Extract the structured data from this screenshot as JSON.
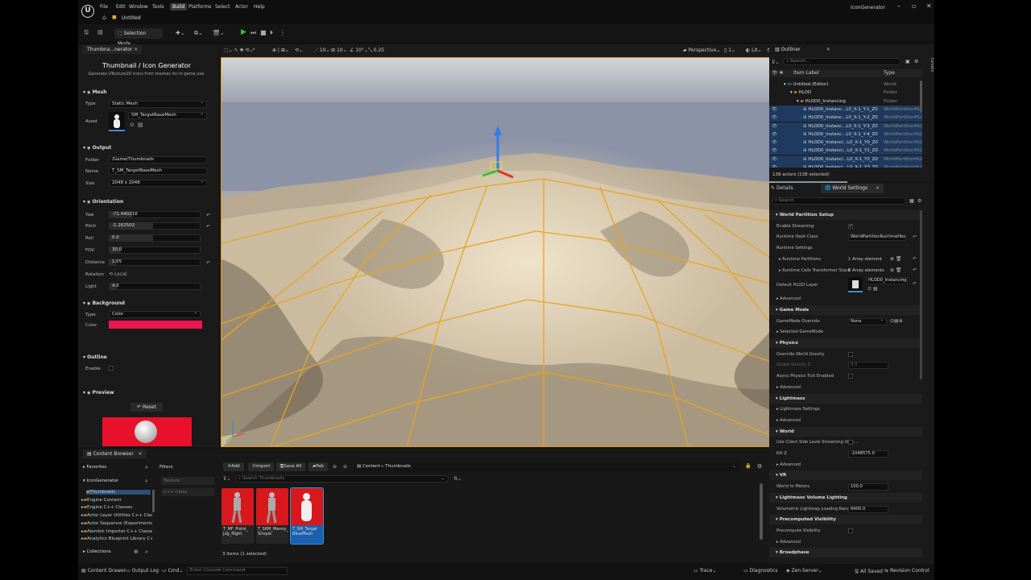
{
  "window": {
    "title": "IconGenerator",
    "tab": "Untitled"
  },
  "menu": [
    "File",
    "Edit",
    "Window",
    "Tools",
    "Build",
    "Platforms",
    "Select",
    "Actor",
    "Help"
  ],
  "toolbar": {
    "mode": "Selection Mode"
  },
  "left_panel": {
    "tab": "Thumbna...nerator",
    "title": "Thumbnail / Icon Generator",
    "subtitle": "Generate UTexture2D icons from meshes for in-game use.",
    "mesh": {
      "section": "Mesh",
      "type_label": "Type",
      "type_value": "Static Mesh",
      "asset_label": "Asset",
      "asset_value": "SM_TargetBaseMesh"
    },
    "output": {
      "section": "Output",
      "folder_label": "Folder",
      "folder_value": "/Game/Thumbnails",
      "name_label": "Name",
      "name_value": "T_SM_TargetBaseMesh",
      "size_label": "Size",
      "size_value": "2048 x 2048"
    },
    "orientation": {
      "section": "Orientation",
      "yaw_label": "Yaw",
      "yaw": "-71.440216",
      "pitch_label": "Pitch",
      "pitch": "-1.262502",
      "roll_label": "Roll",
      "roll": "0.0",
      "fov_label": "FOV",
      "fov": "30.0",
      "distance_label": "Distance",
      "distance": "1.05",
      "rotation_label": "Rotation",
      "rotation_value": "Local",
      "light_label": "Light",
      "light": "4.0"
    },
    "background": {
      "section": "Background",
      "type_label": "Type",
      "type_value": "Color",
      "color_label": "Color",
      "color_hex": "#ee1650"
    },
    "outline": {
      "section": "Outline",
      "enable_label": "Enable"
    },
    "preview": {
      "section": "Preview",
      "reset_label": "Reset"
    }
  },
  "viewport": {
    "view": "Perspective",
    "lit": "Lit",
    "grid_snap": "10",
    "rot_snap": "10°",
    "scale_snap": "0.25",
    "speed": "1"
  },
  "outliner": {
    "tab": "Outliner",
    "search_placeholder": "Search...",
    "col_label": "Item Label",
    "col_type": "Type",
    "rows": [
      {
        "label": "Untitled (Editor)",
        "type": "World",
        "indent": 0,
        "sel": false
      },
      {
        "label": "HLOD",
        "type": "Folder",
        "indent": 1,
        "sel": false
      },
      {
        "label": "HLOD0_Instancing",
        "type": "Folder",
        "indent": 2,
        "sel": false
      },
      {
        "label": "HLOD0_Instanc...L0_X-1_Y-1_Z0",
        "type": "WorldPartitionHLOD",
        "indent": 3,
        "sel": true
      },
      {
        "label": "HLOD0_Instanc...L0_X-1_Y-2_Z0",
        "type": "WorldPartitionHLOD",
        "indent": 3,
        "sel": true
      },
      {
        "label": "HLOD0_Instanc...L0_X-1_Y-3_Z0",
        "type": "WorldPartitionHLOD",
        "indent": 3,
        "sel": true
      },
      {
        "label": "HLOD0_Instanc...L0_X-1_Y-4_Z0",
        "type": "WorldPartitionHLOD",
        "indent": 3,
        "sel": true
      },
      {
        "label": "HLOD0_Instanci...L0_X-1_Y0_Z0",
        "type": "WorldPartitionHLOD",
        "indent": 3,
        "sel": true
      },
      {
        "label": "HLOD0_Instanci...L0_X-1_Y1_Z0",
        "type": "WorldPartitionHLOD",
        "indent": 3,
        "sel": true
      },
      {
        "label": "HLOD0_Instanci...L0_X-1_Y2_Z0",
        "type": "WorldPartitionHLOD",
        "indent": 3,
        "sel": true
      },
      {
        "label": "HLOD0_Instanci...L0_X-1_Y3_Z0",
        "type": "WorldPartitionHLOD",
        "indent": 3,
        "sel": true
      }
    ],
    "count": "138 actors (138 selected)"
  },
  "details": {
    "tab_details": "Details",
    "tab_world": "World Settings",
    "search_placeholder": "Search",
    "items": [
      {
        "kind": "sec",
        "text": "World Partition Setup"
      },
      {
        "kind": "check",
        "text": "Enable Streaming",
        "checked": true
      },
      {
        "kind": "drop",
        "text": "Runtime Hash Class",
        "value": "WorldPartitionRuntimeHashSet"
      },
      {
        "kind": "sub",
        "text": "Runtime Settings"
      },
      {
        "kind": "arr",
        "text": "Runtime Partitions",
        "value": "1 Array element"
      },
      {
        "kind": "arr",
        "text": "Runtime Cells Transformer Stack",
        "value": "0 Array elements"
      },
      {
        "kind": "hlod",
        "text": "Default HLOD Layer",
        "value": "HLOD0_Instancing"
      },
      {
        "kind": "adv",
        "text": "Advanced"
      },
      {
        "kind": "sec",
        "text": "Game Mode"
      },
      {
        "kind": "drop",
        "text": "GameMode Override",
        "value": "None"
      },
      {
        "kind": "adv",
        "text": "Selected GameMode"
      },
      {
        "kind": "sec",
        "text": "Physics"
      },
      {
        "kind": "check",
        "text": "Override World Gravity",
        "checked": false
      },
      {
        "kind": "val",
        "text": "Global Gravity Z",
        "value": "0.0",
        "dim": true
      },
      {
        "kind": "check",
        "text": "Async Physics Tick Enabled",
        "checked": false
      },
      {
        "kind": "adv",
        "text": "Advanced"
      },
      {
        "kind": "sec",
        "text": "Lightmass"
      },
      {
        "kind": "adv",
        "text": "Lightmass Settings"
      },
      {
        "kind": "adv",
        "text": "Advanced"
      },
      {
        "kind": "sec",
        "text": "World"
      },
      {
        "kind": "check",
        "text": "Use Client Side Level Streaming Volu...",
        "checked": false
      },
      {
        "kind": "val",
        "text": "Kill Z",
        "value": "-1048575.0"
      },
      {
        "kind": "adv",
        "text": "Advanced"
      },
      {
        "kind": "sec",
        "text": "VR"
      },
      {
        "kind": "val",
        "text": "World to Meters",
        "value": "100.0"
      },
      {
        "kind": "sec",
        "text": "Lightmass Volume Lighting"
      },
      {
        "kind": "val",
        "text": "Volumetric Lightmap Loading Range",
        "value": "6400.0"
      },
      {
        "kind": "sec",
        "text": "Precomputed Visibility"
      },
      {
        "kind": "check",
        "text": "Precompute Visibility",
        "checked": false
      },
      {
        "kind": "adv",
        "text": "Advanced"
      },
      {
        "kind": "sec",
        "text": "Broadphase"
      }
    ]
  },
  "content_browser": {
    "tab": "Content Browser",
    "favorites": "Favorites",
    "project": "IconGenerator",
    "filters": "Filters",
    "filter_items": [
      "Texture",
      "C++ Class"
    ],
    "add": "Add",
    "import": "Import",
    "save_all": "Save All",
    "fab": "Fab",
    "path": [
      "Content",
      "Thumbnails"
    ],
    "search_placeholder": "Search Thumbnails",
    "tree": [
      "Thumbnails",
      "Engine Content",
      "Engine C++ Classes",
      "Actor Layer Utilities C++ Classe",
      "Actor Sequence (Experimental)",
      "Alembic Importer C++ Classes",
      "Analytics Blueprint Library C++"
    ],
    "collections": "Collections",
    "assets": [
      {
        "name": "T_MF_Pistol_\nJog_Right",
        "selected": false
      },
      {
        "name": "T_SKM_Manny_\nSimple",
        "selected": false
      },
      {
        "name": "T_SM_Target\nBaseMesh",
        "selected": true
      }
    ],
    "count": "3 items (1 selected)"
  },
  "statusbar": {
    "drawer": "Content Drawer",
    "output": "Output Log",
    "cmd": "Cmd",
    "console_placeholder": "Enter Console Command",
    "trace": "Trace",
    "diag": "Diagnostics",
    "zen": "Zen Server",
    "saved": "All Saved",
    "rev": "Revision Control"
  },
  "levels_tab": "Levels"
}
